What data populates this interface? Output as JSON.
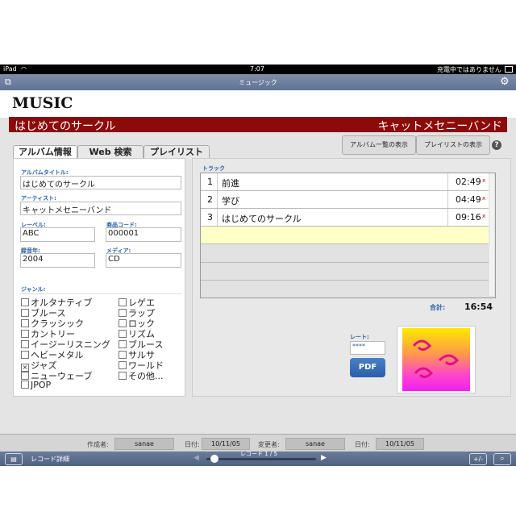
{
  "status": {
    "device": "iPad",
    "time": "7:07",
    "battery": "充電中ではありません"
  },
  "nav": {
    "title": "ミュージック"
  },
  "header": {
    "logo": "MUSIC",
    "album_title": "はじめてのサークル",
    "artist": "キャットメセニーバンド"
  },
  "tabs": [
    "アルバム情報",
    "Web 検索",
    "プレイリスト"
  ],
  "actions": {
    "album_list": "アルバム一覧の表示",
    "playlist": "プレイリストの表示",
    "help": "?"
  },
  "form": {
    "album_title_label": "アルバムタイトル:",
    "album_title_value": "はじめてのサークル",
    "artist_label": "アーティスト:",
    "artist_value": "キャットメセニーバンド",
    "label_label": "レーベル:",
    "label_value": "ABC",
    "code_label": "商品コード:",
    "code_value": "000001",
    "year_label": "録音年:",
    "year_value": "2004",
    "media_label": "メディア:",
    "media_value": "CD",
    "genre_label": "ジャンル:"
  },
  "genres_left": [
    {
      "name": "オルタナティブ",
      "checked": false
    },
    {
      "name": "ブルース",
      "checked": false
    },
    {
      "name": "クラッシック",
      "checked": false
    },
    {
      "name": "カントリー",
      "checked": false
    },
    {
      "name": "イージーリスニング",
      "checked": false
    },
    {
      "name": "ヘビーメタル",
      "checked": false
    },
    {
      "name": "ジャズ",
      "checked": true
    },
    {
      "name": "ニューウェーブ",
      "checked": false
    },
    {
      "name": "JPOP",
      "checked": false
    }
  ],
  "genres_right": [
    {
      "name": "レゲエ",
      "checked": false
    },
    {
      "name": "ラップ",
      "checked": false
    },
    {
      "name": "ロック",
      "checked": false
    },
    {
      "name": "リズム",
      "checked": false
    },
    {
      "name": "ブルース",
      "checked": false
    },
    {
      "name": "サルサ",
      "checked": false
    },
    {
      "name": "ワールド",
      "checked": false
    },
    {
      "name": "その他...",
      "checked": false
    }
  ],
  "tracks": {
    "label": "トラック",
    "rows": [
      {
        "no": "1",
        "title": "前進",
        "time": "02:49"
      },
      {
        "no": "2",
        "title": "学び",
        "time": "04:49"
      },
      {
        "no": "3",
        "title": "はじめてのサークル",
        "time": "09:16"
      }
    ],
    "delete_mark": "x",
    "total_label": "合計:",
    "total_value": "16:54"
  },
  "rating": {
    "label": "レート:",
    "stars": "****"
  },
  "pdf_label": "PDF",
  "footer": {
    "created_by_label": "作成者:",
    "created_by": "sanae",
    "created_date_label": "日付:",
    "created_date": "10/11/05",
    "modified_by_label": "変更者:",
    "modified_by": "sanae",
    "modified_date_label": "日付:",
    "modified_date": "10/11/05"
  },
  "toolbar": {
    "view_label": "レコード詳細",
    "record_label": "レコード 1 / 5",
    "progress": 0.2
  }
}
